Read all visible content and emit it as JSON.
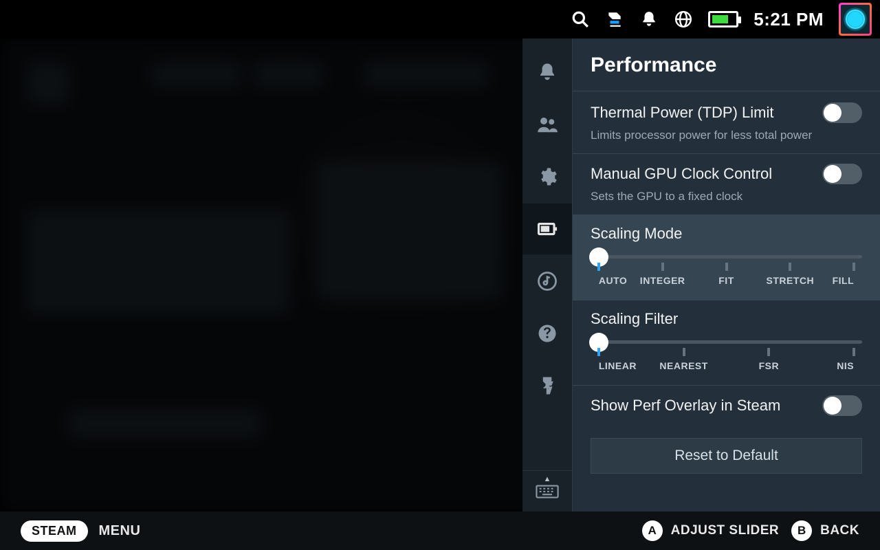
{
  "topbar": {
    "clock": "5:21 PM"
  },
  "panel": {
    "title": "Performance",
    "tdp": {
      "label": "Thermal Power (TDP) Limit",
      "desc": "Limits processor power for less total power",
      "enabled": false
    },
    "gpu": {
      "label": "Manual GPU Clock Control",
      "desc": "Sets the GPU to a fixed clock",
      "enabled": false
    },
    "scaling_mode": {
      "label": "Scaling Mode",
      "value_index": 0,
      "options": [
        "AUTO",
        "INTEGER",
        "FIT",
        "STRETCH",
        "FILL"
      ]
    },
    "scaling_filter": {
      "label": "Scaling Filter",
      "value_index": 0,
      "options": [
        "LINEAR",
        "NEAREST",
        "FSR",
        "NIS"
      ]
    },
    "perf_overlay": {
      "label": "Show Perf Overlay in Steam",
      "enabled": false
    },
    "reset_label": "Reset to Default"
  },
  "bottombar": {
    "steam": "STEAM",
    "menu": "MENU",
    "hints": [
      {
        "button": "A",
        "label": "ADJUST SLIDER"
      },
      {
        "button": "B",
        "label": "BACK"
      }
    ]
  }
}
